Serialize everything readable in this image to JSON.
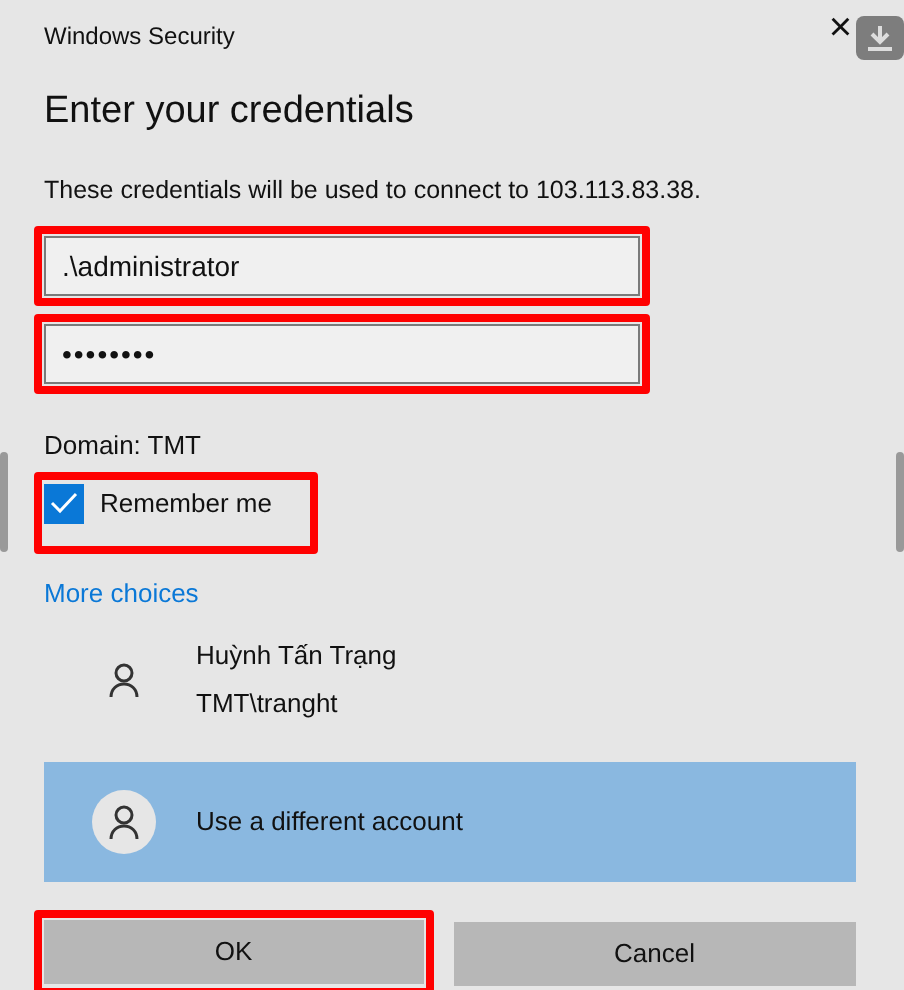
{
  "window": {
    "title": "Windows Security",
    "close": "×"
  },
  "heading": "Enter your credentials",
  "description": "These credentials will be used to connect to 103.113.83.38.",
  "fields": [
    {
      "kind": "text",
      "value": ".\\administrator",
      "highlighted": true
    },
    {
      "kind": "password",
      "value": "••••••••",
      "highlighted": true
    }
  ],
  "domain": "Domain: TMT",
  "remember": {
    "label": "Remember me",
    "checked": true,
    "highlighted": true
  },
  "more_choices": "More choices",
  "accounts": [
    {
      "name": "Huỳnh Tấn Trạng",
      "user": "TMT\\tranght",
      "selected": false
    },
    {
      "name": "Use a different account",
      "selected": true
    }
  ],
  "buttons": [
    {
      "label": "OK",
      "highlighted": true
    },
    {
      "label": "Cancel",
      "highlighted": false
    }
  ]
}
